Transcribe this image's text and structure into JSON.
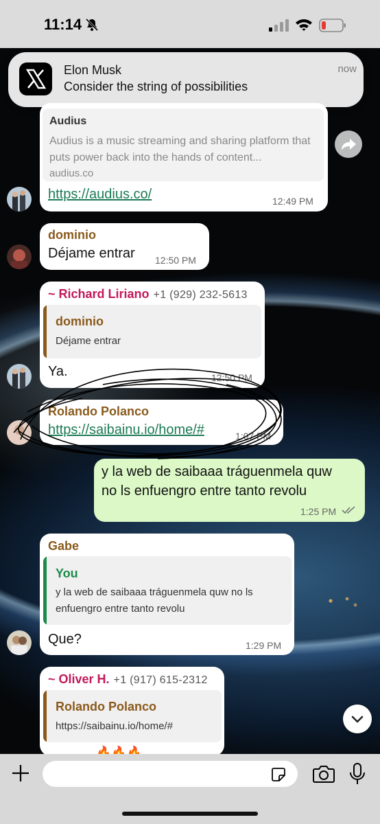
{
  "status_bar": {
    "time": "11:14",
    "silent_icon": "bell-slash-icon",
    "signal_icon": "cellular-signal-icon",
    "wifi_icon": "wifi-icon",
    "battery_icon": "battery-low-icon",
    "battery_color": "#e53935"
  },
  "notification": {
    "app_icon": "x-logo-icon",
    "sender": "Elon Musk",
    "message": "Consider the string of possibilities",
    "time": "now"
  },
  "messages": [
    {
      "type": "link_preview",
      "preview": {
        "title": "Audius",
        "description": "Audius is a music streaming and sharing platform that puts power back into the hands of content...",
        "domain": "audius.co"
      },
      "link": "https://audius.co/",
      "time": "12:49 PM"
    },
    {
      "sender": "dominio",
      "sender_color": "#8a5a1c",
      "text": "Déjame entrar",
      "time": "12:50 PM"
    },
    {
      "sender": "~ Richard Liriano",
      "sender_color": "#c2185b",
      "phone": "+1 (929) 232-5613",
      "quote": {
        "name": "dominio",
        "name_color": "#8a5a1c",
        "text": "Déjame entrar"
      },
      "text": "Ya.",
      "time": "12:50 PM"
    },
    {
      "sender": "Rolando Polanco",
      "sender_color": "#8a5a1c",
      "link": "https://saibainu.io/home/#",
      "time": "1:07 PM"
    },
    {
      "outgoing": true,
      "line1": "y la web de saibaaa tráguenmela quw",
      "line2": "no ls enfuengro entre tanto revolu",
      "time": "1:25 PM",
      "status_icon": "double-check-icon"
    },
    {
      "sender": "Gabe",
      "sender_color": "#8a5a1c",
      "quote": {
        "name": "You",
        "name_color": "#1b8a4a",
        "line1": "y la web de saibaaa tráguenmela quw no ls",
        "line2": "enfuengro entre tanto revolu"
      },
      "text": "Que?",
      "time": "1:29 PM"
    },
    {
      "sender": "~ Oliver H.",
      "sender_color": "#c2185b",
      "phone": "+1 (917) 615-2312",
      "quote": {
        "name": "Rolando Polanco",
        "name_color": "#8a5a1c",
        "text": "https://saibainu.io/home/#"
      },
      "text": "🔥🔥🔥"
    }
  ],
  "composer": {
    "placeholder": "",
    "plus_icon": "plus-icon",
    "sticker_icon": "sticker-icon",
    "camera_icon": "camera-icon",
    "mic_icon": "microphone-icon"
  }
}
